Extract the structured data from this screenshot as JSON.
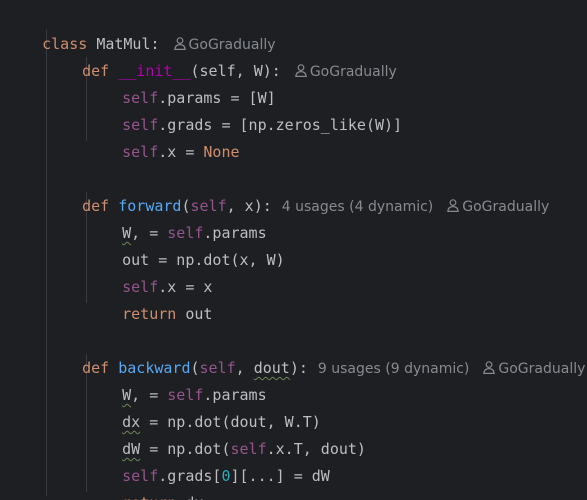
{
  "author_name": "GoGradually",
  "class_decl": {
    "kw": "class",
    "name": "MatMul:"
  },
  "init_def": {
    "kw": "def",
    "name": "__init__",
    "params": "(self, W):"
  },
  "init_body": [
    {
      "self": "self",
      "rest": ".params = [W]"
    },
    {
      "self": "self",
      "rest": ".grads = [np.zeros_like(W)]"
    },
    {
      "self": "self",
      "rest": ".x = ",
      "none": "None"
    }
  ],
  "forward_def": {
    "kw": "def",
    "name": "forward",
    "open": "(",
    "self": "self",
    "close": ", x):",
    "hint": "4 usages (4 dynamic)"
  },
  "forward_body": {
    "l1_w": "W",
    "l1_rest": ", = ",
    "l1_self": "self",
    "l1_tail": ".params",
    "l2": "out = np.dot(x, W)",
    "l3_self": "self",
    "l3_rest": ".x = x",
    "l4_kw": "return",
    "l4_rest": " out"
  },
  "backward_def": {
    "kw": "def",
    "name": "backward",
    "open": "(",
    "self": "self",
    "mid": ", ",
    "dout": "dout",
    "close": "):",
    "hint": "9 usages (9 dynamic)"
  },
  "backward_body": {
    "l1_w": "W",
    "l1_rest": ", = ",
    "l1_self": "self",
    "l1_tail": ".params",
    "l2_var": "dx",
    "l2_rest": " = np.dot(dout, W.T)",
    "l3_var": "dW",
    "l3_a": " = np.dot(",
    "l3_self": "self",
    "l3_b": ".x.T, dout)",
    "l4_self": "self",
    "l4_a": ".grads[",
    "l4_num": "0",
    "l4_b": "][...] = dW",
    "l5_kw": "return",
    "l5_rest": " dx"
  },
  "colors": {
    "background": "#1e1f22",
    "keyword": "#cf8e6d",
    "self": "#94558d",
    "function": "#56a8f5",
    "dunder": "#b200b2",
    "number": "#2aacb8",
    "text": "#bcbec4",
    "hint": "#868a91"
  }
}
